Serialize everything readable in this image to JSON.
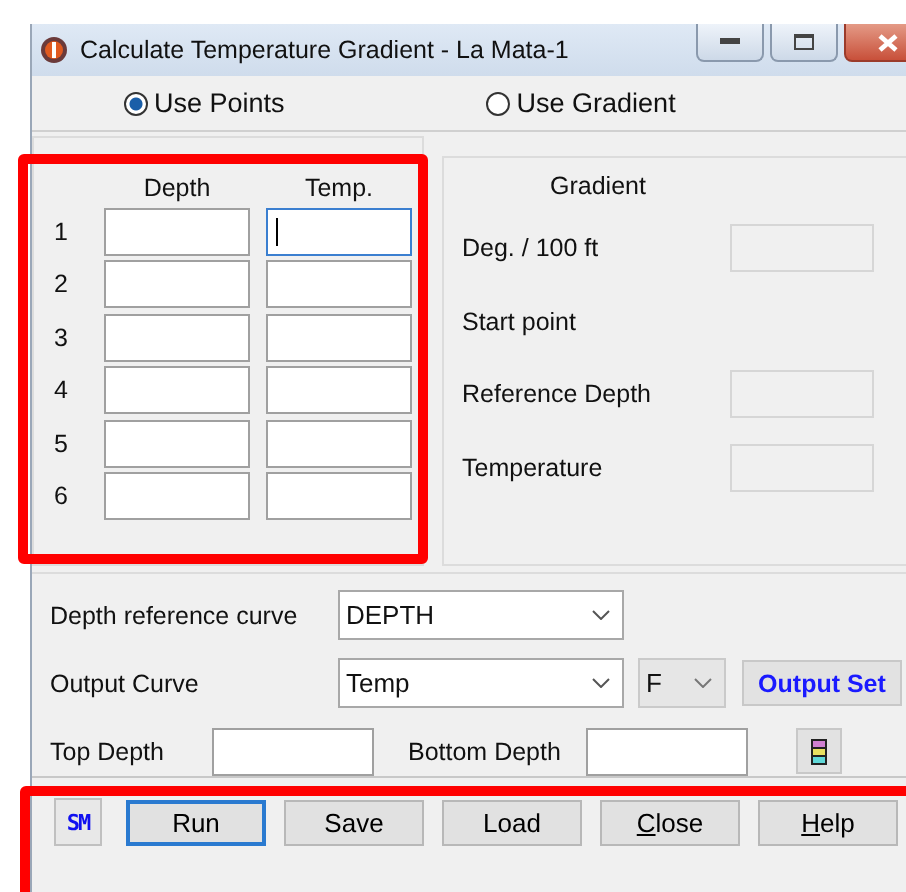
{
  "window": {
    "title": "Calculate Temperature Gradient - La Mata-1"
  },
  "mode_options": [
    {
      "label": "Use Points",
      "selected": true
    },
    {
      "label": "Use Gradient",
      "selected": false
    }
  ],
  "points_table": {
    "highlighted": true,
    "columns": [
      "Depth",
      "Temp."
    ],
    "rows": [
      {
        "number": "1",
        "cells": [
          {
            "focused": false
          },
          {
            "focused": true
          }
        ]
      },
      {
        "number": "2",
        "cells": [
          {
            "focused": false
          },
          {
            "focused": false
          }
        ]
      },
      {
        "number": "3",
        "cells": [
          {
            "focused": false
          },
          {
            "focused": false
          }
        ]
      },
      {
        "number": "4",
        "cells": [
          {
            "focused": false
          },
          {
            "focused": false
          }
        ]
      },
      {
        "number": "5",
        "cells": [
          {
            "focused": false
          },
          {
            "focused": false
          }
        ]
      },
      {
        "number": "6",
        "cells": [
          {
            "focused": false
          },
          {
            "focused": false
          }
        ]
      }
    ]
  },
  "gradient_panel": {
    "title": "Gradient",
    "fields": [
      {
        "label": "Deg. / 100 ft",
        "kind": "field"
      },
      {
        "label": "Start point",
        "kind": "heading"
      },
      {
        "label": "Reference Depth",
        "kind": "field"
      },
      {
        "label": "Temperature",
        "kind": "field"
      }
    ]
  },
  "depth_reference_curve": {
    "label": "Depth reference curve",
    "value": "DEPTH"
  },
  "output_curve": {
    "label": "Output Curve",
    "value": "Temp",
    "unit": "F",
    "button": "Output Set"
  },
  "top_depth": {
    "label": "Top Depth"
  },
  "bottom_depth": {
    "label": "Bottom Depth"
  },
  "buttons": [
    {
      "label": "Run",
      "default": true,
      "underline_first": false
    },
    {
      "label": "Save",
      "default": false,
      "underline_first": false
    },
    {
      "label": "Load",
      "default": false,
      "underline_first": false
    },
    {
      "label": "Close",
      "default": false,
      "underline_first": true
    },
    {
      "label": "Help",
      "default": false,
      "underline_first": true
    }
  ],
  "logo": {
    "text": "SM"
  },
  "button_bar_highlighted": true
}
